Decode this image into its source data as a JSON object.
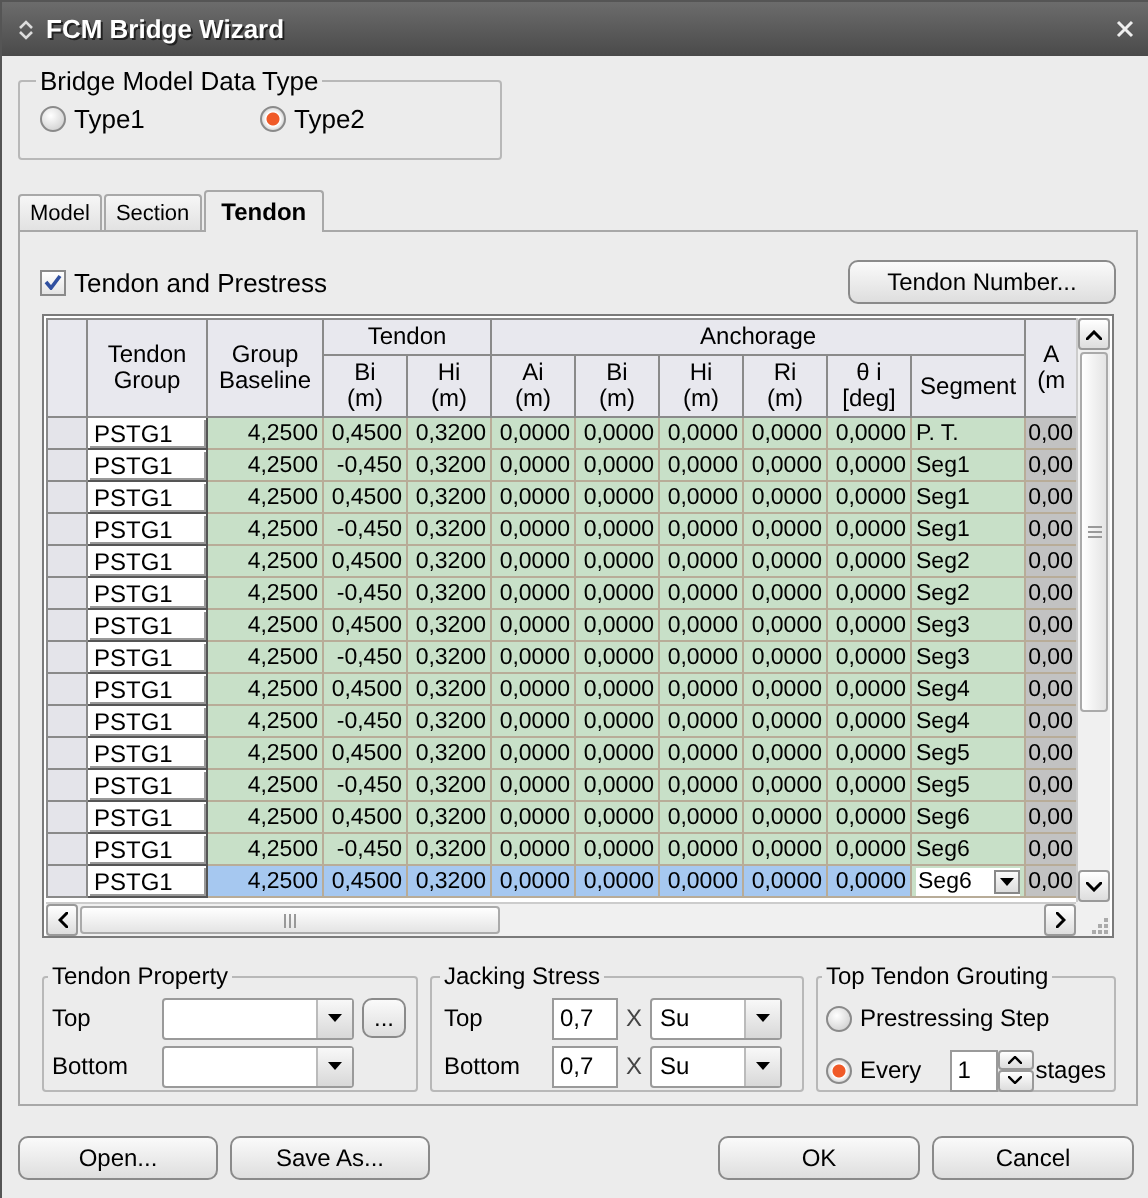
{
  "window": {
    "title": "FCM Bridge Wizard"
  },
  "model_type": {
    "title": "Bridge Model Data Type",
    "options": [
      {
        "label": "Type1",
        "selected": false
      },
      {
        "label": "Type2",
        "selected": true
      }
    ]
  },
  "tabs": [
    {
      "label": "Model",
      "selected": false
    },
    {
      "label": "Section",
      "selected": false
    },
    {
      "label": "Tendon",
      "selected": true
    }
  ],
  "tendon_and_prestress": {
    "label": "Tendon and Prestress",
    "checked": true
  },
  "tendon_number_button": "Tendon Number...",
  "table": {
    "header": [
      {
        "label": "Tendon\nGroup"
      },
      {
        "label": "Group\nBaseline"
      },
      {
        "group": "Tendon",
        "columns": [
          {
            "label": "Bi\n(m)"
          },
          {
            "label": "Hi\n(m)"
          }
        ]
      },
      {
        "group": "Anchorage",
        "columns": [
          {
            "label": "Ai\n(m)"
          },
          {
            "label": "Bi\n(m)"
          },
          {
            "label": "Hi\n(m)"
          },
          {
            "label": "Ri\n(m)"
          },
          {
            "label": "θ i\n[deg]"
          },
          {
            "label": "Segment"
          }
        ]
      },
      {
        "label": "A\n(m"
      }
    ],
    "rows": [
      {
        "selected": false,
        "cells": [
          "PSTG1",
          "4,2500",
          "0,4500",
          "0,3200",
          "0,0000",
          "0,0000",
          "0,0000",
          "0,0000",
          "0,0000",
          "P. T.",
          "0,00"
        ]
      },
      {
        "selected": false,
        "cells": [
          "PSTG1",
          "4,2500",
          "-0,450",
          "0,3200",
          "0,0000",
          "0,0000",
          "0,0000",
          "0,0000",
          "0,0000",
          "Seg1",
          "0,00"
        ]
      },
      {
        "selected": false,
        "cells": [
          "PSTG1",
          "4,2500",
          "0,4500",
          "0,3200",
          "0,0000",
          "0,0000",
          "0,0000",
          "0,0000",
          "0,0000",
          "Seg1",
          "0,00"
        ]
      },
      {
        "selected": false,
        "cells": [
          "PSTG1",
          "4,2500",
          "-0,450",
          "0,3200",
          "0,0000",
          "0,0000",
          "0,0000",
          "0,0000",
          "0,0000",
          "Seg1",
          "0,00"
        ]
      },
      {
        "selected": false,
        "cells": [
          "PSTG1",
          "4,2500",
          "0,4500",
          "0,3200",
          "0,0000",
          "0,0000",
          "0,0000",
          "0,0000",
          "0,0000",
          "Seg2",
          "0,00"
        ]
      },
      {
        "selected": false,
        "cells": [
          "PSTG1",
          "4,2500",
          "-0,450",
          "0,3200",
          "0,0000",
          "0,0000",
          "0,0000",
          "0,0000",
          "0,0000",
          "Seg2",
          "0,00"
        ]
      },
      {
        "selected": false,
        "cells": [
          "PSTG1",
          "4,2500",
          "0,4500",
          "0,3200",
          "0,0000",
          "0,0000",
          "0,0000",
          "0,0000",
          "0,0000",
          "Seg3",
          "0,00"
        ]
      },
      {
        "selected": false,
        "cells": [
          "PSTG1",
          "4,2500",
          "-0,450",
          "0,3200",
          "0,0000",
          "0,0000",
          "0,0000",
          "0,0000",
          "0,0000",
          "Seg3",
          "0,00"
        ]
      },
      {
        "selected": false,
        "cells": [
          "PSTG1",
          "4,2500",
          "0,4500",
          "0,3200",
          "0,0000",
          "0,0000",
          "0,0000",
          "0,0000",
          "0,0000",
          "Seg4",
          "0,00"
        ]
      },
      {
        "selected": false,
        "cells": [
          "PSTG1",
          "4,2500",
          "-0,450",
          "0,3200",
          "0,0000",
          "0,0000",
          "0,0000",
          "0,0000",
          "0,0000",
          "Seg4",
          "0,00"
        ]
      },
      {
        "selected": false,
        "cells": [
          "PSTG1",
          "4,2500",
          "0,4500",
          "0,3200",
          "0,0000",
          "0,0000",
          "0,0000",
          "0,0000",
          "0,0000",
          "Seg5",
          "0,00"
        ]
      },
      {
        "selected": false,
        "cells": [
          "PSTG1",
          "4,2500",
          "-0,450",
          "0,3200",
          "0,0000",
          "0,0000",
          "0,0000",
          "0,0000",
          "0,0000",
          "Seg5",
          "0,00"
        ]
      },
      {
        "selected": false,
        "cells": [
          "PSTG1",
          "4,2500",
          "0,4500",
          "0,3200",
          "0,0000",
          "0,0000",
          "0,0000",
          "0,0000",
          "0,0000",
          "Seg6",
          "0,00"
        ]
      },
      {
        "selected": false,
        "cells": [
          "PSTG1",
          "4,2500",
          "-0,450",
          "0,3200",
          "0,0000",
          "0,0000",
          "0,0000",
          "0,0000",
          "0,0000",
          "Seg6",
          "0,00"
        ]
      },
      {
        "selected": true,
        "cells": [
          "PSTG1",
          "4,2500",
          "0,4500",
          "0,3200",
          "0,0000",
          "0,0000",
          "0,0000",
          "0,0000",
          "0,0000",
          "Seg6",
          "0,00"
        ]
      }
    ]
  },
  "tendon_property": {
    "title": "Tendon Property",
    "rows": [
      {
        "label": "Top",
        "browse": "..."
      },
      {
        "label": "Bottom"
      }
    ]
  },
  "jacking_stress": {
    "title": "Jacking Stress",
    "rows": [
      {
        "label": "Top",
        "factor": "0,7",
        "times": "X",
        "unit": "Su"
      },
      {
        "label": "Bottom",
        "factor": "0,7",
        "times": "X",
        "unit": "Su"
      }
    ]
  },
  "top_tendon_grouting": {
    "title": "Top Tendon Grouting",
    "options": [
      {
        "label": "Prestressing Step",
        "selected": false
      },
      {
        "label": "Every",
        "selected": true
      }
    ],
    "every_value": "1",
    "stages_label": "stages"
  },
  "buttons_left": [
    "Open...",
    "Save As..."
  ],
  "buttons_right": [
    "OK",
    "Cancel"
  ]
}
